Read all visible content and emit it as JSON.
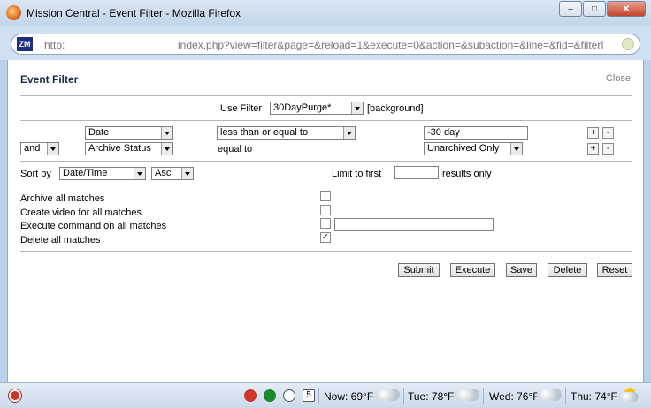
{
  "window": {
    "title": "Mission Central - Event Filter - Mozilla Firefox",
    "minimize": "–",
    "maximize": "□",
    "close": "✕"
  },
  "urlbar": {
    "favicon": "ZM",
    "scheme": "http:",
    "path": "index.php?view=filter&page=&reload=1&execute=0&action=&subaction=&line=&fid=&filterI"
  },
  "page": {
    "heading": "Event Filter",
    "close_label": "Close",
    "use_filter": {
      "label": "Use Filter",
      "value": "30DayPurge*",
      "tag": "[background]"
    },
    "terms": [
      {
        "conjunction": "",
        "attribute": "Date",
        "operator": "less than or equal to",
        "value": "-30 day",
        "plus": "+",
        "minus": "-"
      },
      {
        "conjunction": "and",
        "attribute": "Archive Status",
        "operator": "equal to",
        "value": "Unarchived Only",
        "plus": "+",
        "minus": "-"
      }
    ],
    "sort": {
      "label": "Sort by",
      "field": "Date/Time",
      "direction": "Asc",
      "limit_label": "Limit to first",
      "limit_value": "",
      "limit_suffix": "results only"
    },
    "actions": [
      {
        "label": "Archive all matches",
        "checked": false
      },
      {
        "label": "Create video for all matches",
        "checked": false
      },
      {
        "label": "Execute command on all matches",
        "checked": false,
        "command": ""
      },
      {
        "label": "Delete all matches",
        "checked": true
      }
    ],
    "buttons": {
      "submit": "Submit",
      "execute": "Execute",
      "save": "Save",
      "delete": "Delete",
      "reset": "Reset"
    }
  },
  "statusbar": {
    "clock_day": "5",
    "now": "Now: 69°F",
    "tue": "Tue: 78°F",
    "wed": "Wed: 76°F",
    "thu": "Thu: 74°F"
  },
  "colors": {
    "heading": "#1b2a4a",
    "close_link": "#808080",
    "chrome": "#c2d5eb"
  }
}
